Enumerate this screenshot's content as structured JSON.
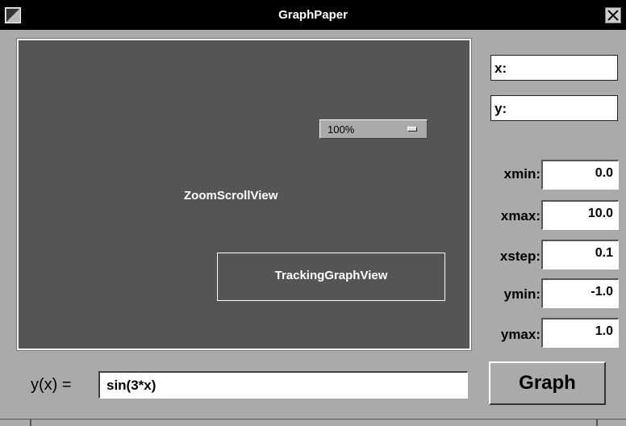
{
  "window": {
    "title": "GraphPaper"
  },
  "graph_area": {
    "scroll_view_label": "ZoomScrollView",
    "zoom": "100%",
    "tracking_view_label": "TrackingGraphView"
  },
  "readouts": {
    "x_label": "x:",
    "y_label": "y:"
  },
  "params": [
    {
      "label": "xmin:",
      "value": "0.0"
    },
    {
      "label": "xmax:",
      "value": "10.0"
    },
    {
      "label": "xstep:",
      "value": "0.1"
    },
    {
      "label": "ymin:",
      "value": "-1.0"
    },
    {
      "label": "ymax:",
      "value": "1.0"
    }
  ],
  "formula": {
    "label": "y(x) =",
    "value": "sin(3*x)"
  },
  "graph_button": "Graph",
  "icons": {
    "miniaturize": "miniaturize-icon",
    "close": "close-icon",
    "zoom_popup": "popup-indicator-icon"
  },
  "colors": {
    "title_bar": "#000000",
    "graph_background": "#555555",
    "window_background": "#aaaaaa"
  }
}
